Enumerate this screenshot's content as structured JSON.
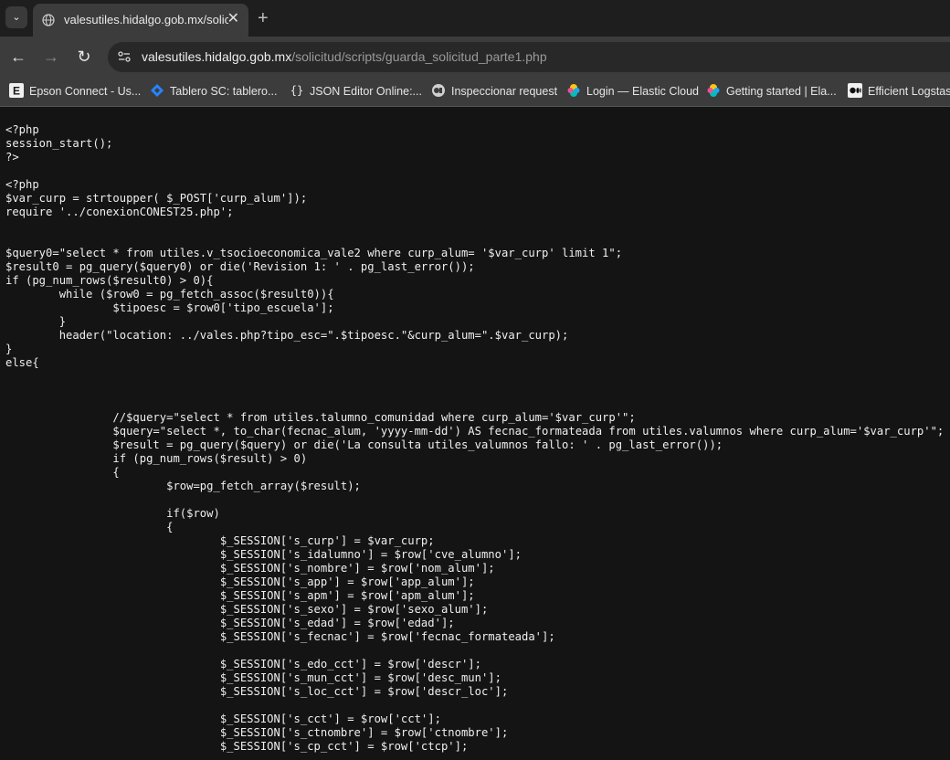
{
  "tab": {
    "title": "valesutiles.hidalgo.gob.mx/solic",
    "close_glyph": "✕",
    "new_tab_glyph": "+",
    "list_glyph": "⌄"
  },
  "nav": {
    "back_glyph": "←",
    "forward_glyph": "→",
    "reload_glyph": "↻"
  },
  "address": {
    "host": "valesutiles.hidalgo.gob.mx",
    "path": "/solicitud/scripts/guarda_solicitud_parte1.php"
  },
  "bookmarks": [
    {
      "label": "Epson Connect - Us...",
      "icon": "epson-icon"
    },
    {
      "label": "Tablero SC: tablero...",
      "icon": "jira-icon"
    },
    {
      "label": "JSON Editor Online:...",
      "icon": "json-icon"
    },
    {
      "label": "Inspeccionar request",
      "icon": "inspect-icon"
    },
    {
      "label": "Login — Elastic Cloud",
      "icon": "elastic-icon"
    },
    {
      "label": "Getting started | Ela...",
      "icon": "elastic-icon"
    },
    {
      "label": "Efficient Logstash",
      "icon": "medium-icon"
    }
  ],
  "code_lines": [
    "<?php",
    "session_start();",
    "?>",
    "",
    "<?php",
    "$var_curp = strtoupper( $_POST['curp_alum']);",
    "require '../conexionCONEST25.php';",
    "",
    "",
    "$query0=\"select * from utiles.v_tsocioeconomica_vale2 where curp_alum= '$var_curp' limit 1\";",
    "$result0 = pg_query($query0) or die('Revision 1: ' . pg_last_error());",
    "if (pg_num_rows($result0) > 0){",
    "\twhile ($row0 = pg_fetch_assoc($result0)){",
    "\t\t$tipoesc = $row0['tipo_escuela'];",
    "\t}",
    "\theader(\"location: ../vales.php?tipo_esc=\".$tipoesc.\"&curp_alum=\".$var_curp);",
    "}",
    "else{",
    "",
    "",
    "",
    "\t\t//$query=\"select * from utiles.talumno_comunidad where curp_alum='$var_curp'\";",
    "\t\t$query=\"select *, to_char(fecnac_alum, 'yyyy-mm-dd') AS fecnac_formateada from utiles.valumnos where curp_alum='$var_curp'\";",
    "\t\t$result = pg_query($query) or die('La consulta utiles_valumnos fallo: ' . pg_last_error());",
    "\t\tif (pg_num_rows($result) > 0)",
    "\t\t{",
    "\t\t\t$row=pg_fetch_array($result);",
    "",
    "\t\t\tif($row)",
    "\t\t\t{",
    "\t\t\t\t$_SESSION['s_curp'] = $var_curp;",
    "\t\t\t\t$_SESSION['s_idalumno'] = $row['cve_alumno'];",
    "\t\t\t\t$_SESSION['s_nombre'] = $row['nom_alum'];",
    "\t\t\t\t$_SESSION['s_app'] = $row['app_alum'];",
    "\t\t\t\t$_SESSION['s_apm'] = $row['apm_alum'];",
    "\t\t\t\t$_SESSION['s_sexo'] = $row['sexo_alum'];",
    "\t\t\t\t$_SESSION['s_edad'] = $row['edad'];",
    "\t\t\t\t$_SESSION['s_fecnac'] = $row['fecnac_formateada'];",
    "",
    "\t\t\t\t$_SESSION['s_edo_cct'] = $row['descr'];",
    "\t\t\t\t$_SESSION['s_mun_cct'] = $row['desc_mun'];",
    "\t\t\t\t$_SESSION['s_loc_cct'] = $row['descr_loc'];",
    "",
    "\t\t\t\t$_SESSION['s_cct'] = $row['cct'];",
    "\t\t\t\t$_SESSION['s_ctnombre'] = $row['ctnombre'];",
    "\t\t\t\t$_SESSION['s_cp_cct'] = $row['ctcp'];"
  ]
}
